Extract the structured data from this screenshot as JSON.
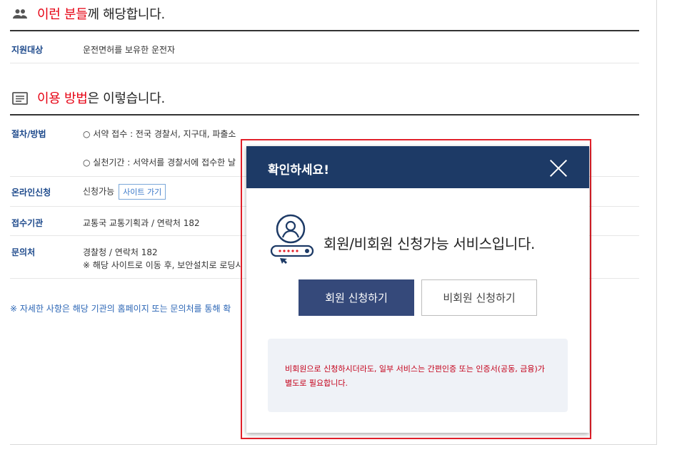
{
  "section1": {
    "title_highlight": "이런 분들",
    "title_rest": "께 해당합니다.",
    "rows": [
      {
        "label": "지원대상",
        "value": "운전면허를 보유한 운전자"
      }
    ]
  },
  "section2": {
    "title_highlight": "이용 방법",
    "title_rest": "은 이렇습니다.",
    "procedure": {
      "label": "절차/방법",
      "items": [
        "○ 서약 접수 : 전국 경찰서, 지구대, 파출소",
        "○ 실천기간 : 서약서를 경찰서에 접수한 날"
      ]
    },
    "online": {
      "label": "온라인신청",
      "value": "신청가능",
      "site_button": "사이트 가기"
    },
    "agency": {
      "label": "접수기관",
      "value": "교통국 교통기획과 / 연락처 182"
    },
    "contact": {
      "label": "문의처",
      "line1": "경찰청 / 연락처 182",
      "line2": "※ 해당 사이트로 이동 후, 보안설치로 로딩시"
    }
  },
  "note": "※ 자세한 사항은 해당 기관의 홈페이지 또는 문의처를 통해 확",
  "modal": {
    "title": "확인하세요!",
    "message": "회원/비회원 신청가능 서비스입니다.",
    "member_button": "회원 신청하기",
    "nonmember_button": "비회원 신청하기",
    "info": "비회원으로 신청하시더라도, 일부 서비스는 간편인증 또는 인증서(공동, 금융)가 별도로 필요합니다."
  },
  "colors": {
    "accent_red": "#e60012",
    "navy": "#1d3a66",
    "button_navy": "#35497a",
    "label_blue": "#1e4a8c"
  }
}
